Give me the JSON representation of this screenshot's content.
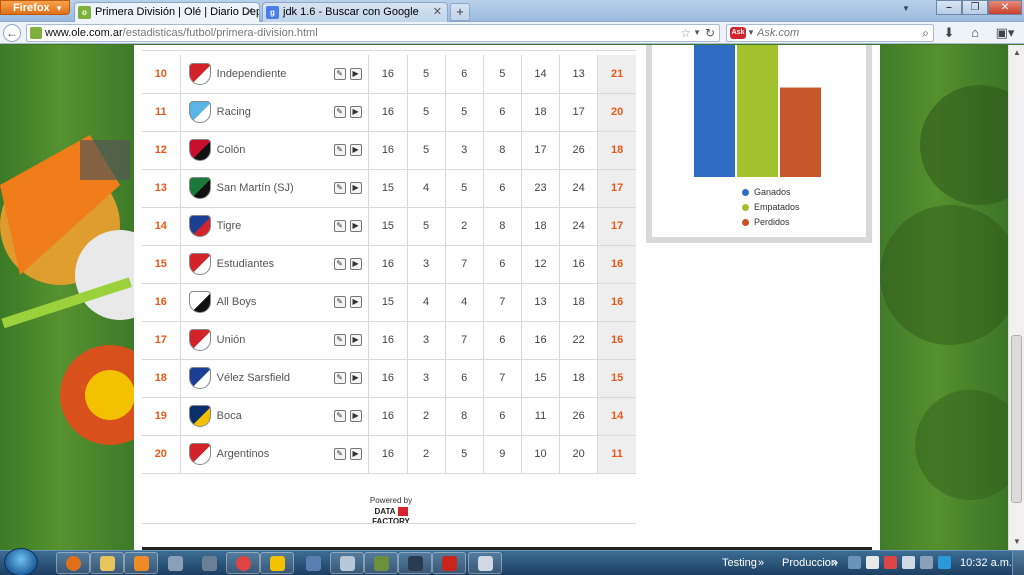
{
  "browser": {
    "menu_button": "Firefox",
    "tabs": [
      {
        "title": "Primera División | Olé | Diario Deporti...",
        "active": true
      },
      {
        "title": "jdk 1.6 - Buscar con Google",
        "active": false
      }
    ],
    "new_tab": "+",
    "url_domain": "www.ole.com.ar",
    "url_path": "/estadisticas/futbol/primera-division.html",
    "search_placeholder": "Ask.com",
    "search_engine_label": "Ask"
  },
  "standings": {
    "rows": [
      {
        "pos": "10",
        "team": "Independiente",
        "crest_colors": [
          "#d2232a",
          "#ffffff"
        ],
        "pj": "16",
        "pg": "5",
        "pe": "6",
        "pp": "5",
        "gf": "14",
        "gc": "13",
        "pts": "21"
      },
      {
        "pos": "11",
        "team": "Racing",
        "crest_colors": [
          "#5ab4e5",
          "#ffffff"
        ],
        "pj": "16",
        "pg": "5",
        "pe": "5",
        "pp": "6",
        "gf": "18",
        "gc": "17",
        "pts": "20"
      },
      {
        "pos": "12",
        "team": "Colón",
        "crest_colors": [
          "#c8102e",
          "#111111"
        ],
        "pj": "16",
        "pg": "5",
        "pe": "3",
        "pp": "8",
        "gf": "17",
        "gc": "26",
        "pts": "18"
      },
      {
        "pos": "13",
        "team": "San Martín (SJ)",
        "crest_colors": [
          "#1a7a3a",
          "#111111"
        ],
        "pj": "15",
        "pg": "4",
        "pe": "5",
        "pp": "6",
        "gf": "23",
        "gc": "24",
        "pts": "17"
      },
      {
        "pos": "14",
        "team": "Tigre",
        "crest_colors": [
          "#1c3f94",
          "#d2232a"
        ],
        "pj": "15",
        "pg": "5",
        "pe": "2",
        "pp": "8",
        "gf": "18",
        "gc": "24",
        "pts": "17"
      },
      {
        "pos": "15",
        "team": "Estudiantes",
        "crest_colors": [
          "#d2232a",
          "#ffffff"
        ],
        "pj": "16",
        "pg": "3",
        "pe": "7",
        "pp": "6",
        "gf": "12",
        "gc": "16",
        "pts": "16"
      },
      {
        "pos": "16",
        "team": "All Boys",
        "crest_colors": [
          "#ffffff",
          "#111111"
        ],
        "pj": "15",
        "pg": "4",
        "pe": "4",
        "pp": "7",
        "gf": "13",
        "gc": "18",
        "pts": "16"
      },
      {
        "pos": "17",
        "team": "Unión",
        "crest_colors": [
          "#d2232a",
          "#ffffff"
        ],
        "pj": "16",
        "pg": "3",
        "pe": "7",
        "pp": "6",
        "gf": "16",
        "gc": "22",
        "pts": "16"
      },
      {
        "pos": "18",
        "team": "Vélez Sarsfield",
        "crest_colors": [
          "#1c3f94",
          "#ffffff"
        ],
        "pj": "16",
        "pg": "3",
        "pe": "6",
        "pp": "7",
        "gf": "15",
        "gc": "18",
        "pts": "15"
      },
      {
        "pos": "19",
        "team": "Boca",
        "crest_colors": [
          "#0a2f6b",
          "#f2c200"
        ],
        "pj": "16",
        "pg": "2",
        "pe": "8",
        "pp": "6",
        "gf": "11",
        "gc": "26",
        "pts": "14"
      },
      {
        "pos": "20",
        "team": "Argentinos",
        "crest_colors": [
          "#d2232a",
          "#ffffff"
        ],
        "pj": "16",
        "pg": "2",
        "pe": "5",
        "pp": "9",
        "gf": "10",
        "gc": "20",
        "pts": "11"
      }
    ],
    "edit_icon": "pencil-icon",
    "play_icon": "play-icon"
  },
  "powered_by": {
    "label": "Powered by",
    "logo_left": "DATA",
    "logo_right": "FACTORY"
  },
  "chart": {
    "colors": {
      "Ganados": "#2f6cc4",
      "Empatados": "#a2c22d",
      "Perdidos": "#c5562a"
    }
  },
  "chart_data": {
    "type": "bar",
    "series": [
      {
        "name": "Ganados",
        "values": [
          5
        ]
      },
      {
        "name": "Empatados",
        "values": [
          4
        ]
      },
      {
        "name": "Perdidos",
        "values": [
          2.6
        ]
      }
    ]
  },
  "taskbar": {
    "labels": [
      "Testing",
      "Produccion"
    ],
    "chevron": "»",
    "clock": "10:32 a.m."
  },
  "colors": {
    "accent_orange": "#e8591a",
    "firefox_orange": "#e0711a",
    "pitch_green": "#3f7a28"
  }
}
